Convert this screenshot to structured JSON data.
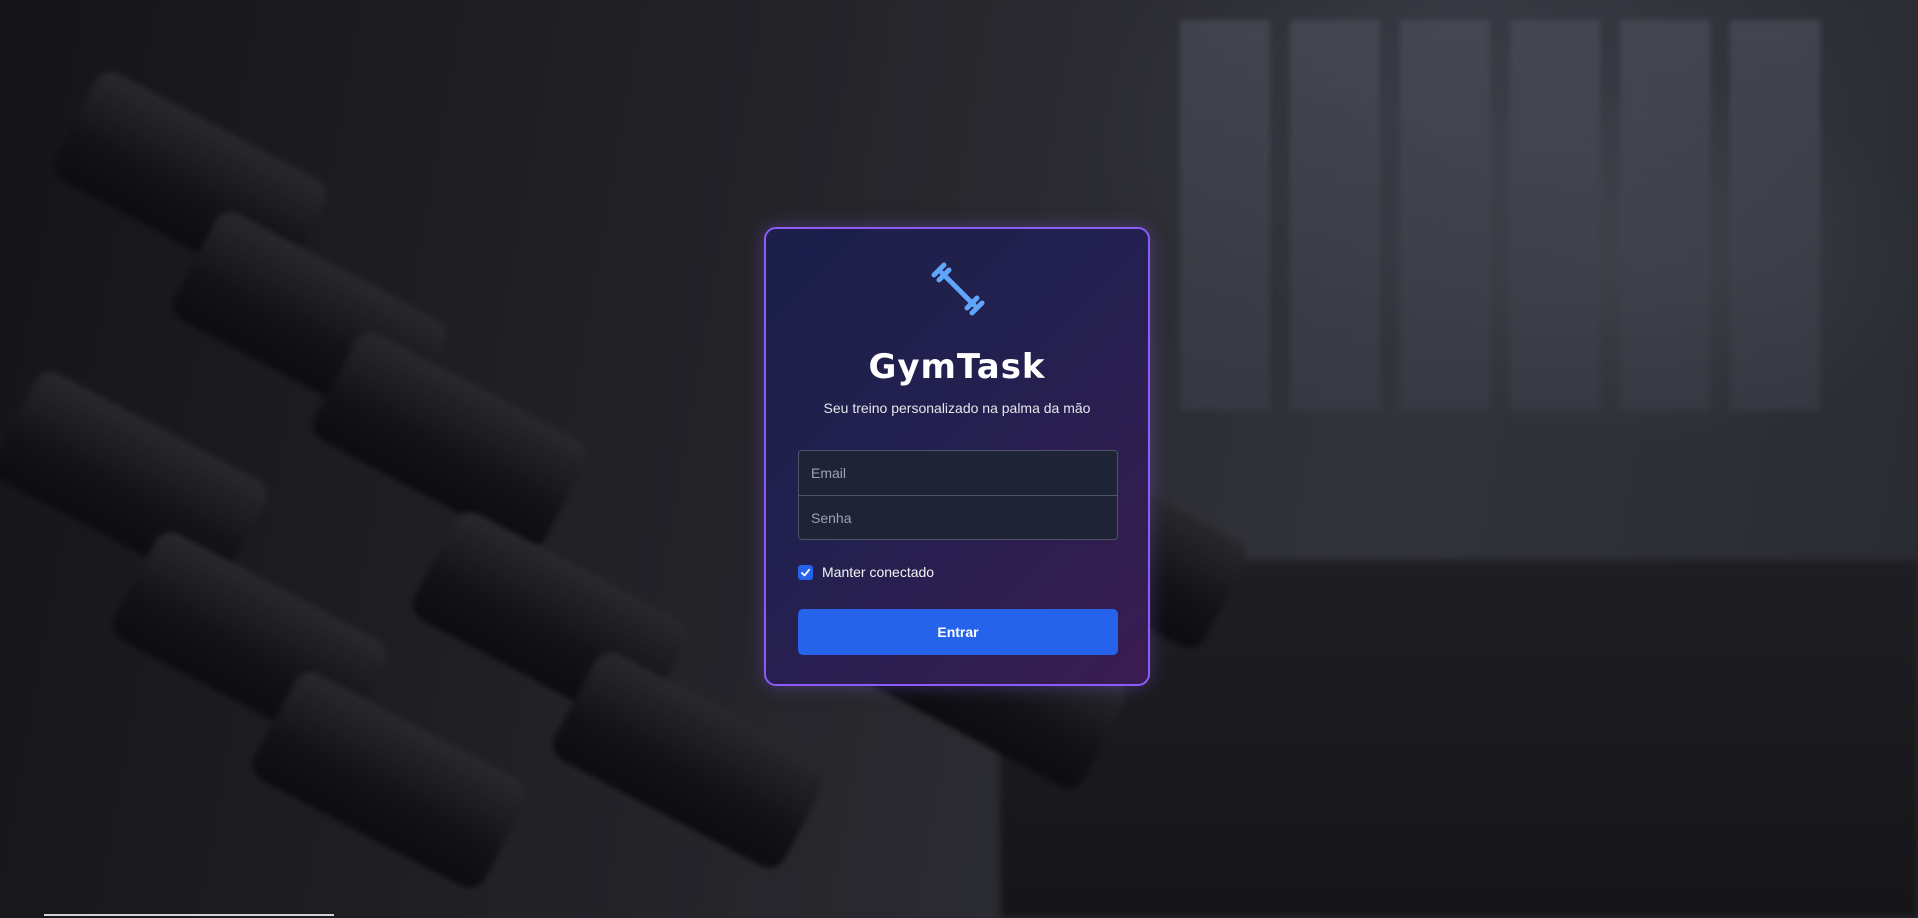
{
  "app": {
    "title": "GymTask",
    "subtitle": "Seu treino personalizado na palma da mão",
    "logo_icon": "dumbbell-icon"
  },
  "form": {
    "email_placeholder": "Email",
    "email_value": "",
    "password_placeholder": "Senha",
    "password_value": "",
    "remember_label": "Manter conectado",
    "remember_checked": true,
    "submit_label": "Entrar"
  },
  "colors": {
    "accent": "#2563eb",
    "logo": "#60a5fa",
    "card_border": "#8b5cf6"
  }
}
